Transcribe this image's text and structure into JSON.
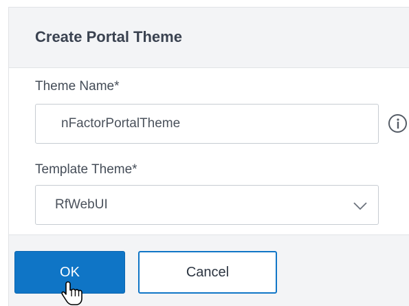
{
  "dialog": {
    "title": "Create Portal Theme"
  },
  "form": {
    "theme_name": {
      "label": "Theme Name*",
      "value": "nFactorPortalTheme",
      "info_icon": "info-icon"
    },
    "template_theme": {
      "label": "Template Theme*",
      "selected": "RfWebUI",
      "dropdown_icon": "chevron-down-icon"
    }
  },
  "footer": {
    "ok_label": "OK",
    "cancel_label": "Cancel"
  },
  "cursor": {
    "icon": "hand-pointer-icon"
  },
  "colors": {
    "primary": "#0f75c6",
    "header_bg": "#f3f4f6",
    "title_text": "#3a4250"
  }
}
